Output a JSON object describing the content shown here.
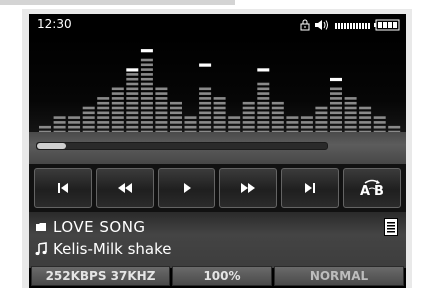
{
  "status": {
    "time": "12:30",
    "icons": [
      "lock-icon",
      "volume-icon",
      "battery-icon"
    ]
  },
  "equalizer": {
    "bars": [
      2,
      4,
      4,
      6,
      8,
      10,
      13,
      16,
      10,
      7,
      4,
      10,
      8,
      4,
      7,
      11,
      7,
      4,
      4,
      6,
      10,
      8,
      6,
      4,
      2
    ],
    "peaks": [
      0,
      0,
      0,
      0,
      0,
      0,
      14,
      18,
      0,
      0,
      0,
      15,
      0,
      0,
      0,
      14,
      0,
      0,
      0,
      0,
      12,
      0,
      0,
      0,
      0
    ],
    "max_level": 20
  },
  "progress": {
    "fraction": 0.1
  },
  "controls": [
    {
      "name": "previous-track-icon"
    },
    {
      "name": "rewind-icon"
    },
    {
      "name": "play-icon"
    },
    {
      "name": "fast-forward-icon"
    },
    {
      "name": "next-track-icon"
    },
    {
      "name": "ab-repeat-icon",
      "label": "A  B"
    }
  ],
  "now_playing": {
    "folder": "LOVE SONG",
    "track": "Kelis-Milk shake"
  },
  "info_bar": {
    "bitrate": "252KBPS 37KHZ",
    "volume": "100%",
    "mode": "NORMAL"
  },
  "colors": {
    "screen_bg": "#000000",
    "bar_color": "#8a8a8a",
    "peak_color": "#ffffff"
  }
}
